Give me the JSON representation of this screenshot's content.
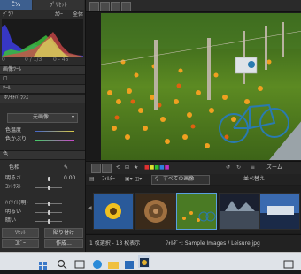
{
  "left": {
    "tabs": [
      "Ê¼",
      "ﾌﾟﾘｾｯﾄ"
    ],
    "histogram_label": "ｸﾞﾗﾌ",
    "color_label": "ｶﾗｰ",
    "all_label": "全体",
    "histogram_x": [
      "0",
      "0 / 1/3",
      "0 - 45"
    ],
    "sections": [
      "画像ﾂｰﾙ",
      "ﾂｰﾙ",
      "ﾎﾜｲﾄﾊﾞﾗﾝｽ",
      "色"
    ],
    "wb_value": "元画像",
    "wb_rows": [
      "色温度",
      "色かぶり"
    ],
    "hue_sat": "色相",
    "sliders": [
      "明るさ",
      "ｺﾝﾄﾗｽﾄ",
      "",
      "ﾊｲﾗｲﾄ(明)",
      "明るい",
      "暗い"
    ],
    "value_dim": "0.00",
    "footer_left": [
      "ﾘｾｯﾄ",
      "貼り付け"
    ],
    "footer_right": [
      "ｺﾋﾟｰ",
      "作成..."
    ],
    "panel_tab": "ﾌﾟﾘｾｯﾄ"
  },
  "browser": {
    "filter_label": "ﾌｨﾙﾀｰ",
    "filter_value": "すべての画像",
    "sort_label": "並べ替え",
    "zoom_label": "ズーム",
    "view_label": "ﾋﾞｭｰ"
  },
  "status": {
    "left": "1 枚選択 - 13 枚表示",
    "right": "ﾌｫﾙﾀﾞｰ: Sample Images / Leisure.jpg"
  },
  "colors": {
    "accent": "#5aa0e0",
    "tab_active": "#3d5f8f"
  }
}
